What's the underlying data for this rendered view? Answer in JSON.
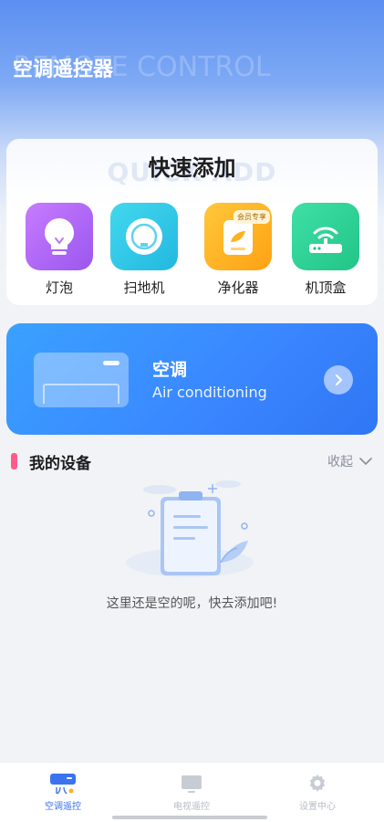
{
  "header": {
    "title": "空调遥控器",
    "watermark": "REMOTE CONTROL"
  },
  "quick_add": {
    "title": "快速添加",
    "watermark": "QUICK ADD",
    "items": [
      {
        "label": "灯泡",
        "icon": "light-bulb-icon",
        "color": "#b36cf5"
      },
      {
        "label": "扫地机",
        "icon": "robot-vacuum-icon",
        "color": "#2fd0e8"
      },
      {
        "label": "净化器",
        "icon": "air-purifier-icon",
        "color": "#ffb21e",
        "badge": "会员专享"
      },
      {
        "label": "机顶盒",
        "icon": "set-top-box-icon",
        "color": "#2fd39a"
      }
    ]
  },
  "ac_card": {
    "title": "空调",
    "subtitle": "Air conditioning"
  },
  "my_devices": {
    "title": "我的设备",
    "collapse_label": "收起",
    "empty_text": "这里还是空的呢，快去添加吧!"
  },
  "tabbar": {
    "tabs": [
      {
        "label": "空调遥控",
        "icon": "ac-remote-icon",
        "active": true
      },
      {
        "label": "电视遥控",
        "icon": "tv-icon",
        "active": false
      },
      {
        "label": "设置中心",
        "icon": "gear-icon",
        "active": false
      }
    ]
  },
  "colors": {
    "accent": "#3a86ff",
    "section_bar": "#ff5b8a",
    "tab_active": "#3a72f0",
    "tab_inactive": "#b7bcc4"
  }
}
